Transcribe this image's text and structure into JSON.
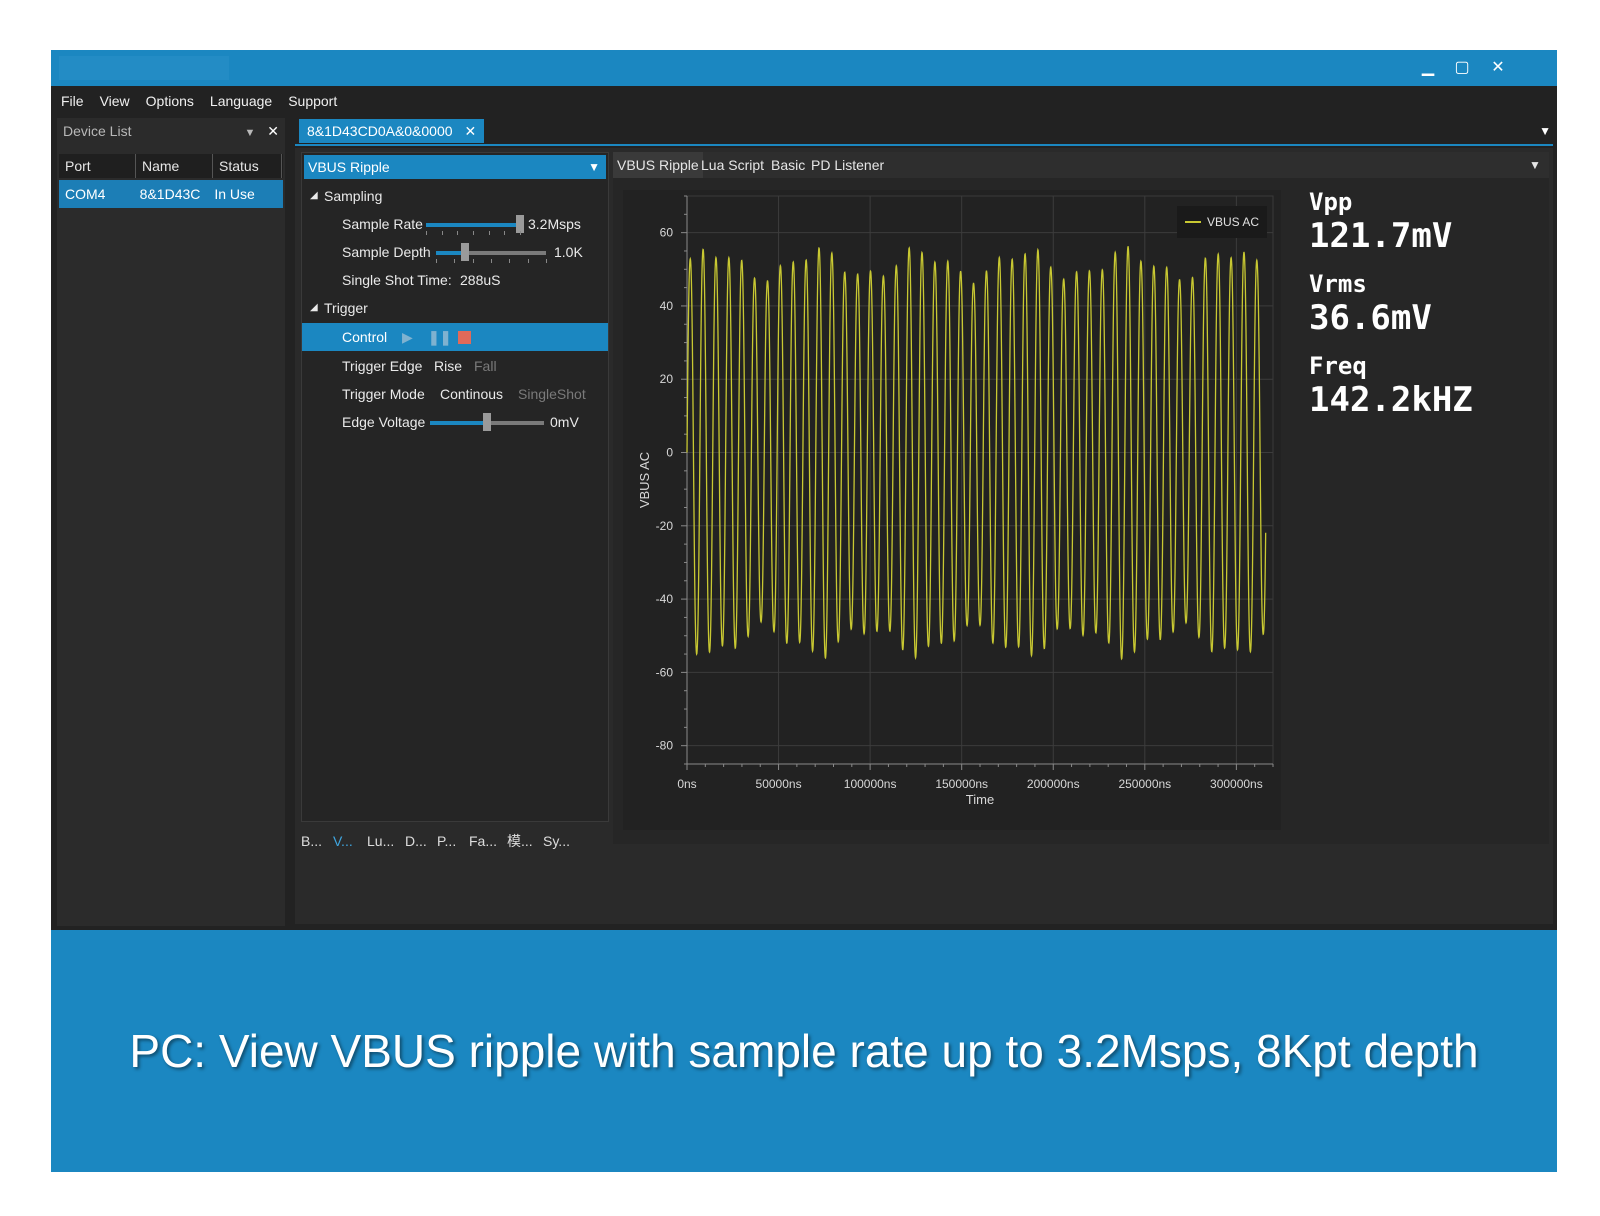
{
  "window": {
    "minimize": "▁",
    "maximize": "▢",
    "close": "✕"
  },
  "menu": [
    "File",
    "View",
    "Options",
    "Language",
    "Support"
  ],
  "device_list": {
    "title": "Device List",
    "columns": [
      "Port",
      "Name",
      "Status"
    ],
    "rows": [
      {
        "port": "COM4",
        "name": "8&1D43C",
        "status": "In Use"
      }
    ]
  },
  "doc_tab": "8&1D43CD0A&0&0000",
  "props": {
    "selector": "VBUS Ripple",
    "sampling_header": "Sampling",
    "sample_rate_label": "Sample Rate",
    "sample_rate_value": "3.2Msps",
    "sample_rate_level": 1.0,
    "sample_depth_label": "Sample Depth",
    "sample_depth_value": "1.0K",
    "sample_depth_level": 0.26,
    "single_shot_label": "Single Shot Time:",
    "single_shot_value": "288uS",
    "trigger_header": "Trigger",
    "control_label": "Control",
    "trigger_edge_label": "Trigger Edge",
    "trigger_edge_rise": "Rise",
    "trigger_edge_fall": "Fall",
    "trigger_mode_label": "Trigger Mode",
    "trigger_mode_cont": "Continous",
    "trigger_mode_single": "SingleShot",
    "edge_voltage_label": "Edge Voltage",
    "edge_voltage_value": "0mV",
    "edge_voltage_level": 0.5
  },
  "bottom_tabs": [
    "B...",
    "V...",
    "Lu...",
    "D...",
    "P...",
    "Fa...",
    "模...",
    "Sy..."
  ],
  "chart_tabs": [
    "VBUS Ripple",
    "Lua Script",
    "Basic",
    "PD Listener"
  ],
  "measurements": [
    {
      "label": "Vpp",
      "value": "121.7mV"
    },
    {
      "label": "Vrms",
      "value": "36.6mV"
    },
    {
      "label": "Freq",
      "value": "142.2kHZ"
    }
  ],
  "chart_data": {
    "type": "line",
    "xlabel": "Time",
    "ylabel": "VBUS AC",
    "xlim": [
      0,
      320000
    ],
    "ylim": [
      -85,
      70
    ],
    "xticks": [
      0,
      50000,
      100000,
      150000,
      200000,
      250000,
      300000
    ],
    "xtick_labels": [
      "0ns",
      "50000ns",
      "100000ns",
      "150000ns",
      "200000ns",
      "250000ns",
      "300000ns"
    ],
    "yticks": [
      60,
      40,
      20,
      0,
      -20,
      -40,
      -60,
      -80
    ],
    "ytick_labels": [
      "60",
      "40",
      "20",
      "0",
      "-20",
      "-40",
      "-60",
      "-80"
    ],
    "grid": true,
    "legend_position": "top-right",
    "series": [
      {
        "name": "VBUS AC",
        "color": "#c8c832",
        "frequency_hz": 142200,
        "amplitude": 58,
        "x_end": 316000
      }
    ]
  },
  "caption": "PC: View VBUS ripple with sample rate up to 3.2Msps, 8Kpt depth",
  "colors": {
    "accent": "#1b87c1",
    "app_bg": "#222222",
    "trace": "#c8c832",
    "stop": "#e06a5a"
  }
}
